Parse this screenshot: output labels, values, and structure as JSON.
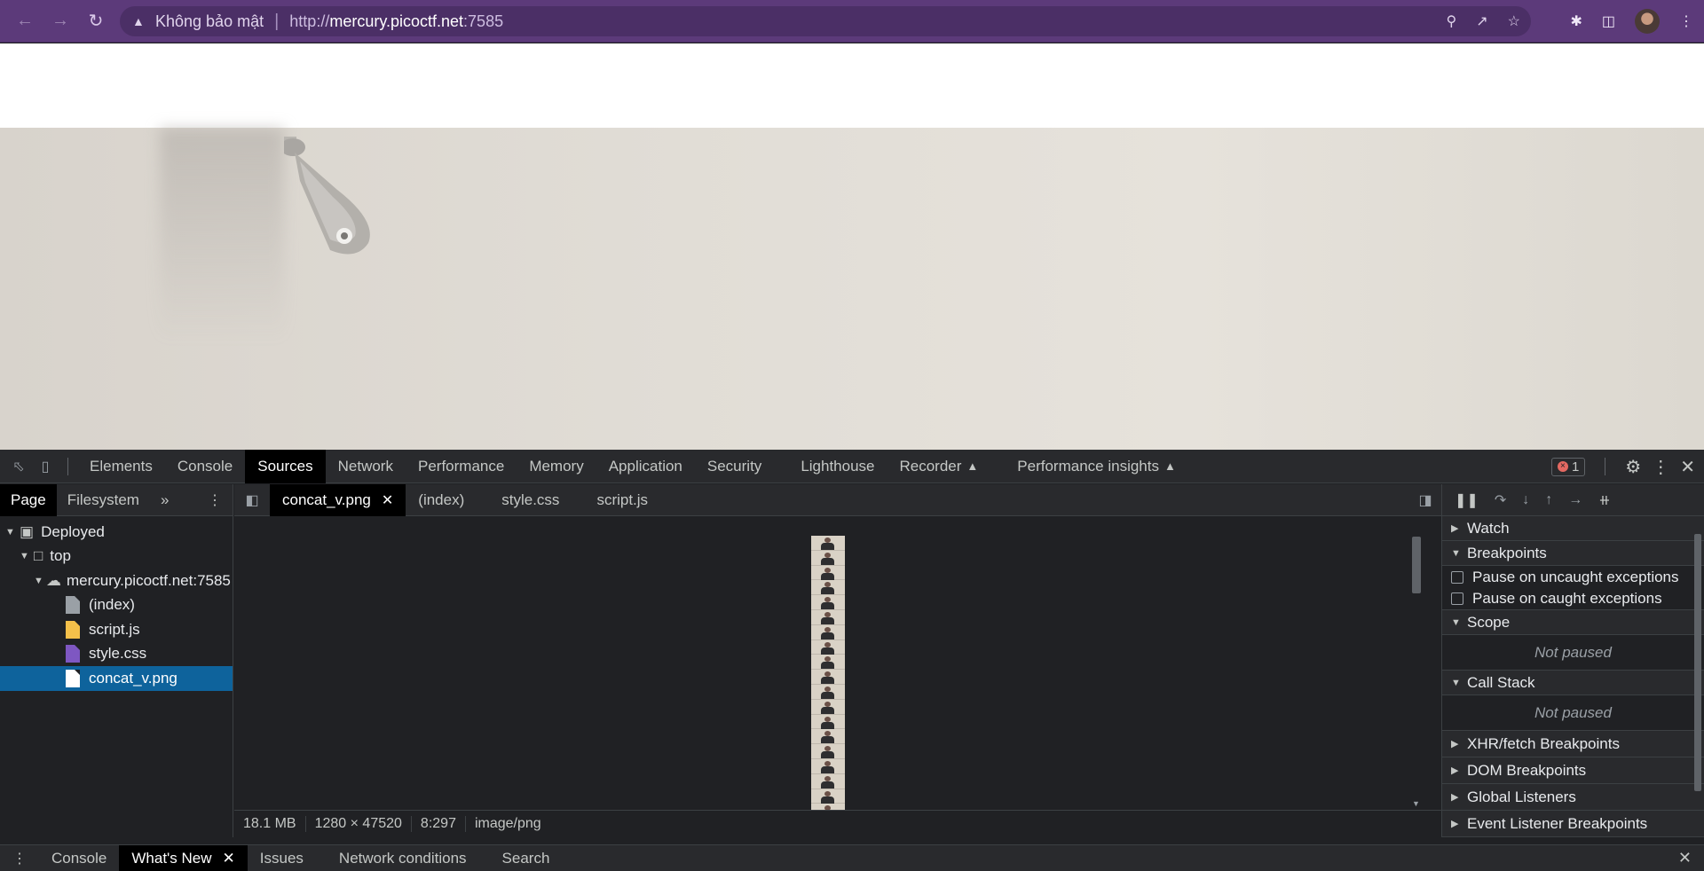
{
  "browser": {
    "security_label": "Không bảo mật",
    "url_prefix": "http://",
    "url_host": "mercury.picoctf.net",
    "url_port": ":7585",
    "icons": [
      "back-icon",
      "forward-icon",
      "reload-icon",
      "warning-icon",
      "zoom-icon",
      "share-icon",
      "star-icon",
      "extensions-icon",
      "sidepanel-icon",
      "avatar",
      "kebab-menu-icon"
    ]
  },
  "devtools": {
    "tabs": [
      "Elements",
      "Console",
      "Sources",
      "Network",
      "Performance",
      "Memory",
      "Application",
      "Security",
      "Lighthouse",
      "Recorder",
      "Performance insights"
    ],
    "active_tab": "Sources",
    "error_count": "1",
    "navigator": {
      "tabs": [
        "Page",
        "Filesystem"
      ],
      "active_tab": "Page",
      "tree": {
        "deployed": "Deployed",
        "top": "top",
        "origin": "mercury.picoctf.net:7585",
        "files": [
          {
            "name": "(index)",
            "color": "#9aa0a6"
          },
          {
            "name": "script.js",
            "color": "#f4c04a"
          },
          {
            "name": "style.css",
            "color": "#7e57c2"
          },
          {
            "name": "concat_v.png",
            "color": "#ffffff"
          }
        ],
        "selected": "concat_v.png"
      }
    },
    "editor": {
      "tabs": [
        "concat_v.png",
        "(index)",
        "style.css",
        "script.js"
      ],
      "active_tab": "concat_v.png",
      "status": {
        "size": "18.1 MB",
        "dimensions": "1280 × 47520",
        "position": "8:297",
        "mime": "image/png"
      }
    },
    "debugger": {
      "watch": "Watch",
      "breakpoints": "Breakpoints",
      "pause_uncaught": "Pause on uncaught exceptions",
      "pause_caught": "Pause on caught exceptions",
      "scope": "Scope",
      "not_paused_scope": "Not paused",
      "call_stack": "Call Stack",
      "not_paused_stack": "Not paused",
      "xhr": "XHR/fetch Breakpoints",
      "dom": "DOM Breakpoints",
      "global": "Global Listeners",
      "event": "Event Listener Breakpoints"
    },
    "drawer": {
      "tabs": [
        "Console",
        "What's New",
        "Issues",
        "Network conditions",
        "Search"
      ],
      "active_tab": "What's New"
    }
  }
}
